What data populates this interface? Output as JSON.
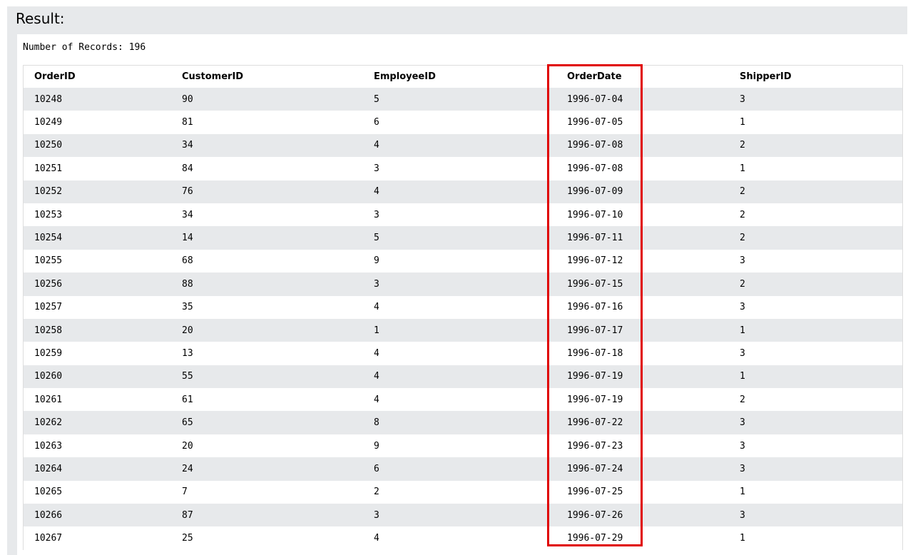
{
  "result_title": "Result:",
  "record_count": "Number of Records: 196",
  "table": {
    "headers": [
      "OrderID",
      "CustomerID",
      "EmployeeID",
      "OrderDate",
      "ShipperID"
    ],
    "rows": [
      [
        "10248",
        "90",
        "5",
        "1996-07-04",
        "3"
      ],
      [
        "10249",
        "81",
        "6",
        "1996-07-05",
        "1"
      ],
      [
        "10250",
        "34",
        "4",
        "1996-07-08",
        "2"
      ],
      [
        "10251",
        "84",
        "3",
        "1996-07-08",
        "1"
      ],
      [
        "10252",
        "76",
        "4",
        "1996-07-09",
        "2"
      ],
      [
        "10253",
        "34",
        "3",
        "1996-07-10",
        "2"
      ],
      [
        "10254",
        "14",
        "5",
        "1996-07-11",
        "2"
      ],
      [
        "10255",
        "68",
        "9",
        "1996-07-12",
        "3"
      ],
      [
        "10256",
        "88",
        "3",
        "1996-07-15",
        "2"
      ],
      [
        "10257",
        "35",
        "4",
        "1996-07-16",
        "3"
      ],
      [
        "10258",
        "20",
        "1",
        "1996-07-17",
        "1"
      ],
      [
        "10259",
        "13",
        "4",
        "1996-07-18",
        "3"
      ],
      [
        "10260",
        "55",
        "4",
        "1996-07-19",
        "1"
      ],
      [
        "10261",
        "61",
        "4",
        "1996-07-19",
        "2"
      ],
      [
        "10262",
        "65",
        "8",
        "1996-07-22",
        "3"
      ],
      [
        "10263",
        "20",
        "9",
        "1996-07-23",
        "3"
      ],
      [
        "10264",
        "24",
        "6",
        "1996-07-24",
        "3"
      ],
      [
        "10265",
        "7",
        "2",
        "1996-07-25",
        "1"
      ],
      [
        "10266",
        "87",
        "3",
        "1996-07-26",
        "3"
      ],
      [
        "10267",
        "25",
        "4",
        "1996-07-29",
        "1"
      ]
    ]
  },
  "colors": {
    "highlight_border": "#e00000",
    "stripe": "#e7e9eb",
    "frame": "#e7e9eb"
  }
}
